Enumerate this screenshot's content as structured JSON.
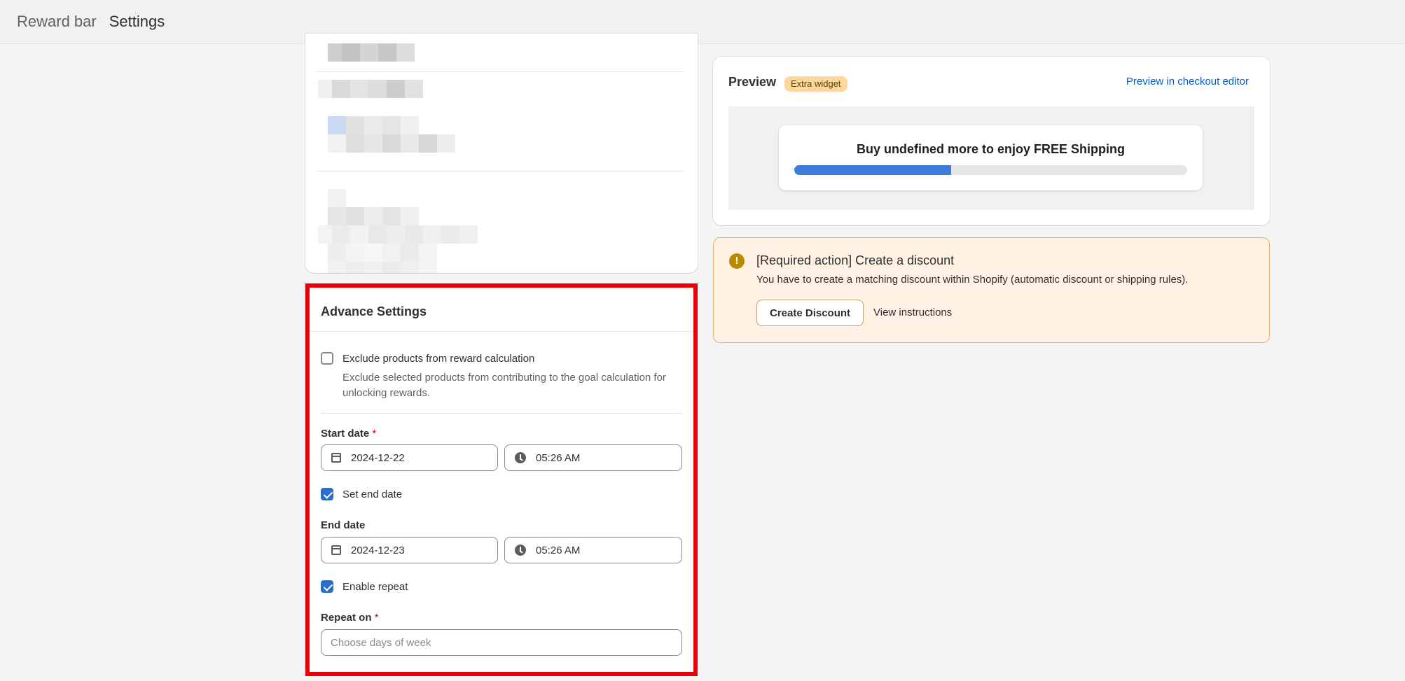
{
  "header": {
    "breadcrumb_parent": "Reward bar",
    "title": "Settings"
  },
  "advance_settings": {
    "title": "Advance Settings",
    "exclude_products": {
      "label": "Exclude products from reward calculation",
      "help": "Exclude selected products from contributing to the goal calculation for unlocking rewards.",
      "checked": false
    },
    "start_date": {
      "label": "Start date",
      "required_mark": "*",
      "date": "2024-12-22",
      "time": "05:26 AM"
    },
    "set_end_date": {
      "label": "Set end date",
      "checked": true
    },
    "end_date": {
      "label": "End date",
      "date": "2024-12-23",
      "time": "05:26 AM"
    },
    "enable_repeat": {
      "label": "Enable repeat",
      "checked": true
    },
    "repeat_on": {
      "label": "Repeat on",
      "required_mark": "*",
      "placeholder": "Choose days of week"
    }
  },
  "preview": {
    "title": "Preview",
    "badge": "Extra widget",
    "link": "Preview in checkout editor",
    "bar_text": "Buy undefined more to enjoy FREE Shipping",
    "progress_fraction": 0.4
  },
  "required_action": {
    "title": "[Required action] Create a discount",
    "text": "You have to create a matching discount within Shopify (automatic discount or shipping rules).",
    "create_button": "Create Discount",
    "view_link": "View instructions"
  },
  "colors": {
    "accent": "#2c6ecb",
    "highlight_border": "#e8000b",
    "warning_bg": "#fff1e3",
    "progress_fill": "#3c7bdc"
  }
}
